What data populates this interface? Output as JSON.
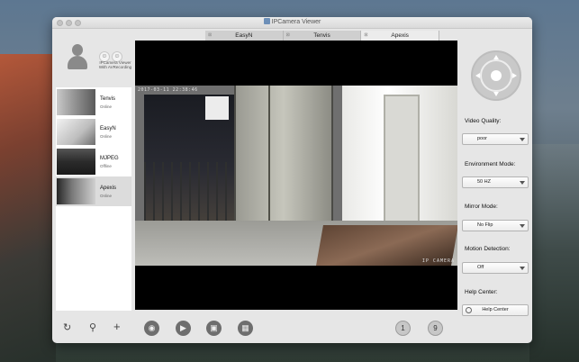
{
  "window": {
    "title": "IPCamera Viewer"
  },
  "tabs": [
    {
      "label": "EasyN",
      "active": false
    },
    {
      "label": "Tenvis",
      "active": false
    },
    {
      "label": "Apexis",
      "active": true
    }
  ],
  "profile": {
    "caption_line1": "IPCamera Viewer",
    "caption_line2": "With AVRecording"
  },
  "cameras": [
    {
      "name": "Tenvis",
      "status": "Online"
    },
    {
      "name": "EasyN",
      "status": "Online"
    },
    {
      "name": "MJPEG",
      "status": "Offline"
    },
    {
      "name": "Apexis",
      "status": "Online"
    }
  ],
  "video": {
    "osd_time": "2017-03-11 22:38:46",
    "osd_name": "IP CAMERA"
  },
  "settings": {
    "video_quality_label": "Video Quality:",
    "video_quality_value": "poor",
    "environment_mode_label": "Environment Mode:",
    "environment_mode_value": "50 HZ",
    "mirror_mode_label": "Mirror Mode:",
    "mirror_mode_value": "No Flip",
    "motion_detection_label": "Motion Detection:",
    "motion_detection_value": "Off",
    "help_center_label": "Help Center:",
    "help_center_button": "Help Center"
  },
  "toolbar": {
    "refresh_icon": "refresh-icon",
    "search_icon": "search-icon",
    "add_icon": "add-icon",
    "snapshot_icon": "camera-icon",
    "record_icon": "video-icon",
    "gallery_icon": "image-icon",
    "film_icon": "film-icon",
    "layout_1_label": "1",
    "layout_9_label": "9"
  }
}
